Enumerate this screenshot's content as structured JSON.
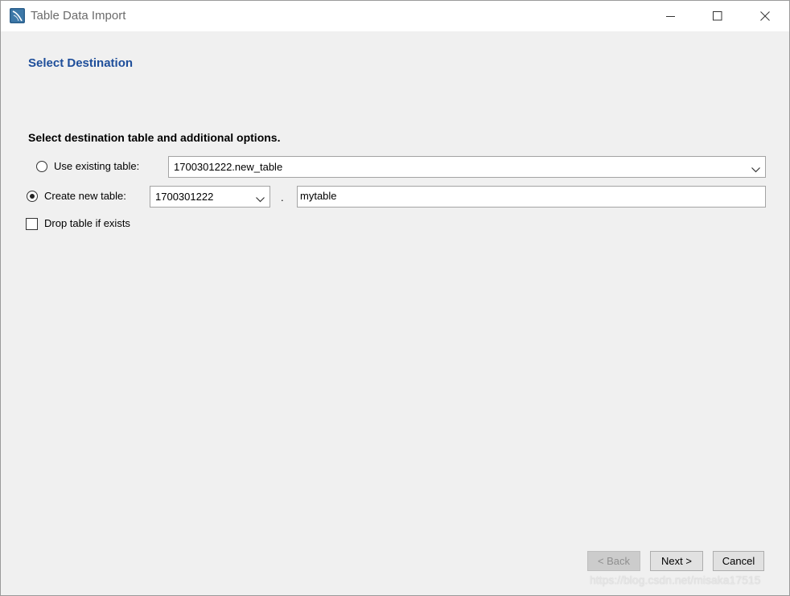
{
  "window": {
    "title": "Table Data Import",
    "icon": "mysql-workbench-icon",
    "controls": [
      "minimize-icon",
      "maximize-icon",
      "close-icon"
    ]
  },
  "page": {
    "section_title": "Select Destination",
    "subtitle": "Select destination table and additional options."
  },
  "existing_table": {
    "label": "Use existing table:",
    "selected": false,
    "value": "1700301222.new_table"
  },
  "new_table": {
    "label": "Create new table:",
    "selected": true,
    "schema": "1700301222",
    "separator": ".",
    "table_name": "mytable"
  },
  "drop_table": {
    "label": "Drop table if exists",
    "checked": false
  },
  "footer": {
    "back_label": "< Back",
    "back_enabled": false,
    "next_label": "Next >",
    "cancel_label": "Cancel",
    "watermark": "https://blog.csdn.net/misaka17515"
  },
  "colors": {
    "section_title": "#1e4e9a",
    "window_bg": "#f0f0f0",
    "titlebar_bg": "#ffffff"
  }
}
